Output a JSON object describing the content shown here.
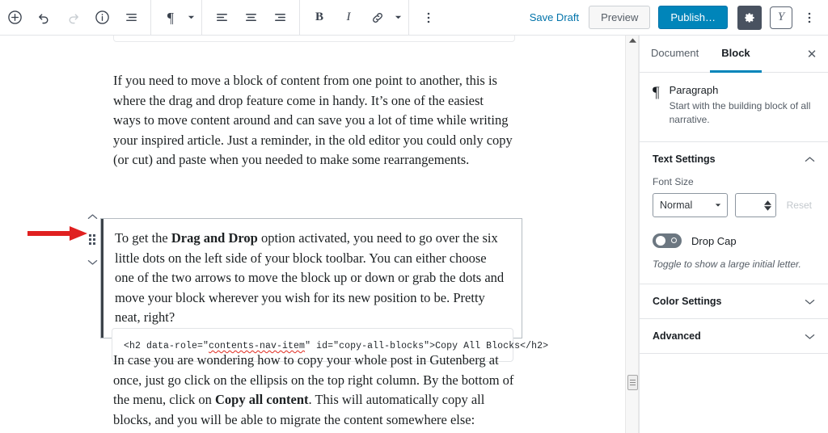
{
  "toolbar": {
    "left_icons": [
      {
        "name": "add-block-icon",
        "label": "Add block"
      },
      {
        "name": "undo-icon",
        "label": "Undo"
      },
      {
        "name": "redo-icon",
        "label": "Redo",
        "disabled": true
      },
      {
        "name": "content-info-icon",
        "label": "Content structure"
      },
      {
        "name": "block-navigation-icon",
        "label": "Block navigation"
      }
    ],
    "block_type_label": "¶",
    "align_icons": [
      {
        "name": "align-left-icon",
        "label": "Align left"
      },
      {
        "name": "align-center-icon",
        "label": "Align center"
      },
      {
        "name": "align-right-icon",
        "label": "Align right"
      }
    ],
    "bold_label": "B",
    "italic_label": "I",
    "link_label": "link-icon",
    "more_label": "more-options-icon",
    "save_draft_label": "Save Draft",
    "preview_label": "Preview",
    "publish_label": "Publish…",
    "settings_gear_label": "gear-icon",
    "yoast_label": "Y",
    "ellipsis_label": "⋮"
  },
  "editor": {
    "paragraph_1": {
      "text": "If you need to move a block of content from one point to another, this is where the drag and drop feature come in handy. It’s one of the easiest ways to move content around and can save you a lot of time while writing your inspired article. Just a reminder, in the old editor you could only copy (or cut) and paste when you needed to make some rearrangements."
    },
    "selected_paragraph": {
      "part_1": "To get the ",
      "bold_1": "Drag and Drop",
      "part_2": " option activated, you need to go over the six little dots on the left side of your block toolbar. You can either choose one of the two arrows to move the block up or down or grab the dots and move your block wherever you wish for its new position to be. Pretty neat, right?"
    },
    "code_block": {
      "before": "<h2 data-role=\"",
      "misspelled": "contents-nav-item",
      "after": "\" id=\"copy-all-blocks\">Copy All Blocks</h2>"
    },
    "paragraph_3": {
      "part_1": "In case you are wondering how to copy your whole post in Gutenberg at once, just go click on the ellipsis on the top right column. By the bottom of the menu, click on ",
      "bold_1": "Copy all content",
      "part_2": ". This will automatically copy all blocks, and you will be able to migrate the content somewhere else:"
    },
    "mover": {
      "up_label": "move-up-icon",
      "drag_label": "drag-handle-icon",
      "down_label": "move-down-icon"
    },
    "annotation": {
      "name": "red-arrow-annotation",
      "color": "#e02020"
    }
  },
  "sidebar": {
    "tabs": [
      {
        "label": "Document",
        "active": false
      },
      {
        "label": "Block",
        "active": true
      }
    ],
    "close_label": "✕",
    "block_info": {
      "icon": "¶",
      "title": "Paragraph",
      "description": "Start with the building block of all narrative."
    },
    "text_settings": {
      "title": "Text Settings",
      "font_size_label": "Font Size",
      "font_size_value": "Normal",
      "font_size_number": "",
      "reset_label": "Reset",
      "drop_cap_label": "Drop Cap",
      "drop_cap_help": "Toggle to show a large initial letter."
    },
    "sections": [
      {
        "label": "Color Settings"
      },
      {
        "label": "Advanced"
      }
    ]
  },
  "colors": {
    "publish_blue": "#0085ba",
    "link_blue": "#0073aa",
    "tab_accent": "#0085ba",
    "gear_bg": "#495260",
    "arrow_red": "#e02020"
  }
}
